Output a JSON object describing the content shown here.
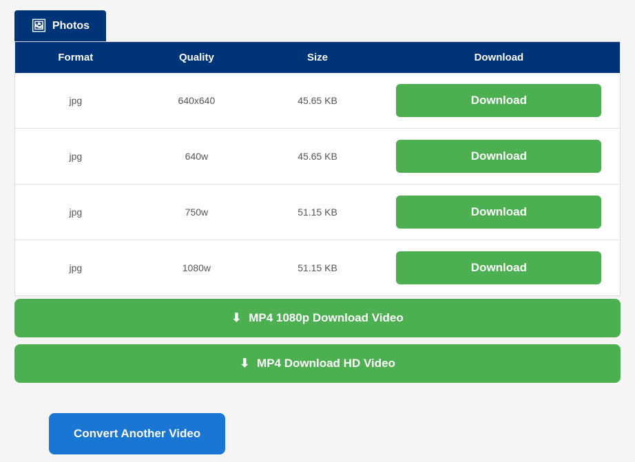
{
  "tab": {
    "icon": "🖼",
    "label": "Photos"
  },
  "table": {
    "headers": [
      "Format",
      "Quality",
      "Size",
      "Download"
    ],
    "rows": [
      {
        "format": "jpg",
        "quality": "640x640",
        "size": "45.65 KB",
        "download": "Download"
      },
      {
        "format": "jpg",
        "quality": "640w",
        "size": "45.65 KB",
        "download": "Download"
      },
      {
        "format": "jpg",
        "quality": "750w",
        "size": "51.15 KB",
        "download": "Download"
      },
      {
        "format": "jpg",
        "quality": "1080w",
        "size": "51.15 KB",
        "download": "Download"
      }
    ]
  },
  "big_buttons": [
    {
      "label": "MP4 1080p Download Video"
    },
    {
      "label": "MP4 Download HD Video"
    }
  ],
  "convert_button": {
    "label": "Convert Another Video"
  }
}
